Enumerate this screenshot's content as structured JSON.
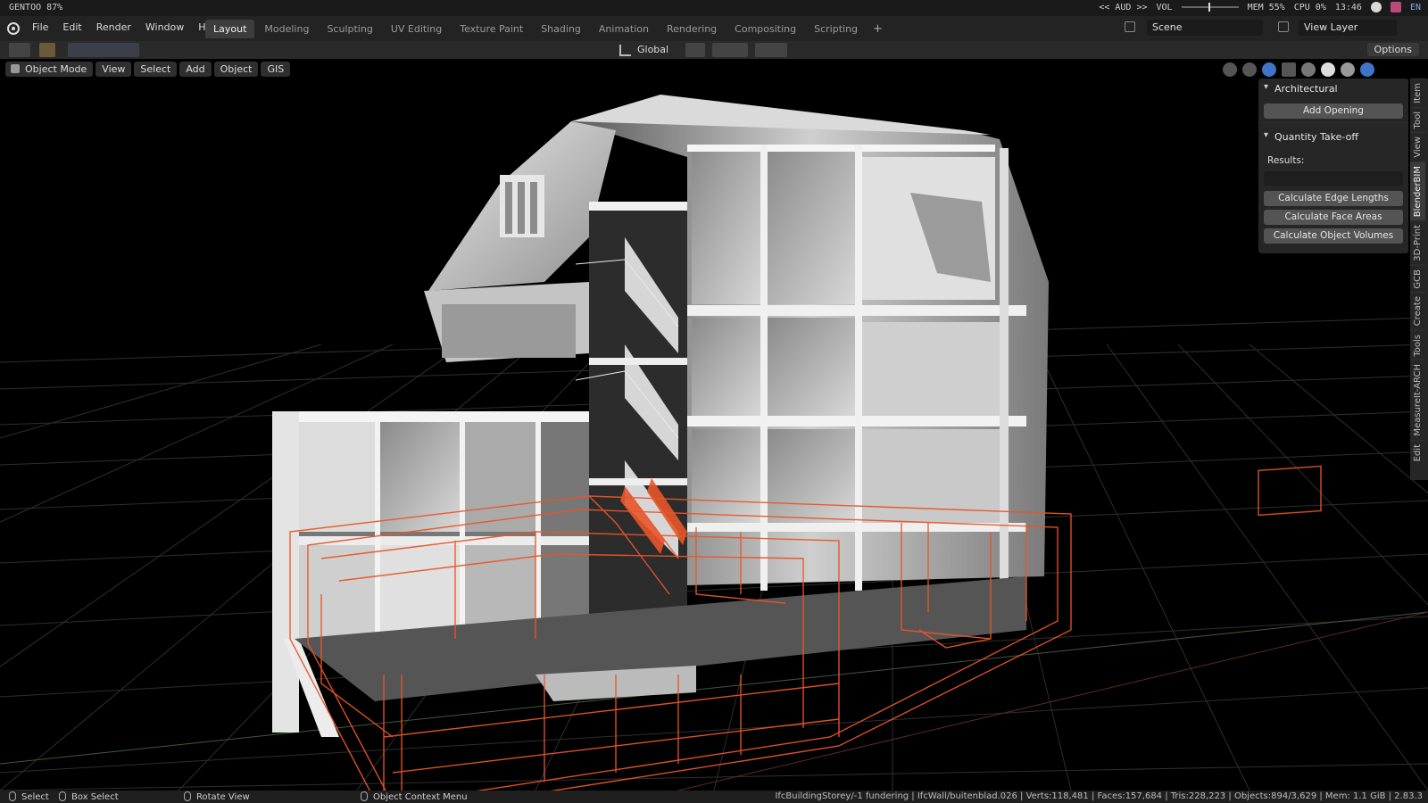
{
  "sysbar": {
    "host": "GENTOO 87%",
    "aud": "<< AUD >>",
    "vol": "VOL",
    "mem": "MEM 55%",
    "cpu": "CPU 0%",
    "clock": "13:46",
    "lang": "EN"
  },
  "menu": [
    "File",
    "Edit",
    "Render",
    "Window",
    "Help"
  ],
  "workspaces": [
    "Layout",
    "Modeling",
    "Sculpting",
    "UV Editing",
    "Texture Paint",
    "Shading",
    "Animation",
    "Rendering",
    "Compositing",
    "Scripting"
  ],
  "workspace_add": "+",
  "scene": "Scene",
  "view_layer": "View Layer",
  "toolheader": {
    "orientation": "Global",
    "options": "Options"
  },
  "viewport": {
    "mode": "Object Mode",
    "menus": [
      "View",
      "Select",
      "Add",
      "Object",
      "GIS"
    ]
  },
  "npanel": {
    "architectural_title": "Architectural",
    "add_opening": "Add Opening",
    "qto_title": "Quantity Take-off",
    "results_label": "Results:",
    "edge_lengths": "Calculate Edge Lengths",
    "face_areas": "Calculate Face Areas",
    "object_volumes": "Calculate Object Volumes"
  },
  "sidetabs": [
    "Item",
    "Tool",
    "View",
    "BlenderBIM",
    "3D-Print",
    "GCB",
    "Create",
    "Tools",
    "MeasureIt-ARCH",
    "Edit"
  ],
  "status": {
    "select": "Select",
    "box_select": "Box Select",
    "rotate_view": "Rotate View",
    "context_menu": "Object Context Menu",
    "stats": "IfcBuildingStorey/-1 fundering | IfcWall/buitenblad.026 | Verts:118,481 | Faces:157,684 | Tris:228,223 | Objects:894/3,629 | Mem: 1.1 GiB | 2.83.3"
  },
  "colors": {
    "accent_orange": "#e8562a",
    "active_blue": "#3f74c6",
    "grid": "#2e2e2e"
  }
}
